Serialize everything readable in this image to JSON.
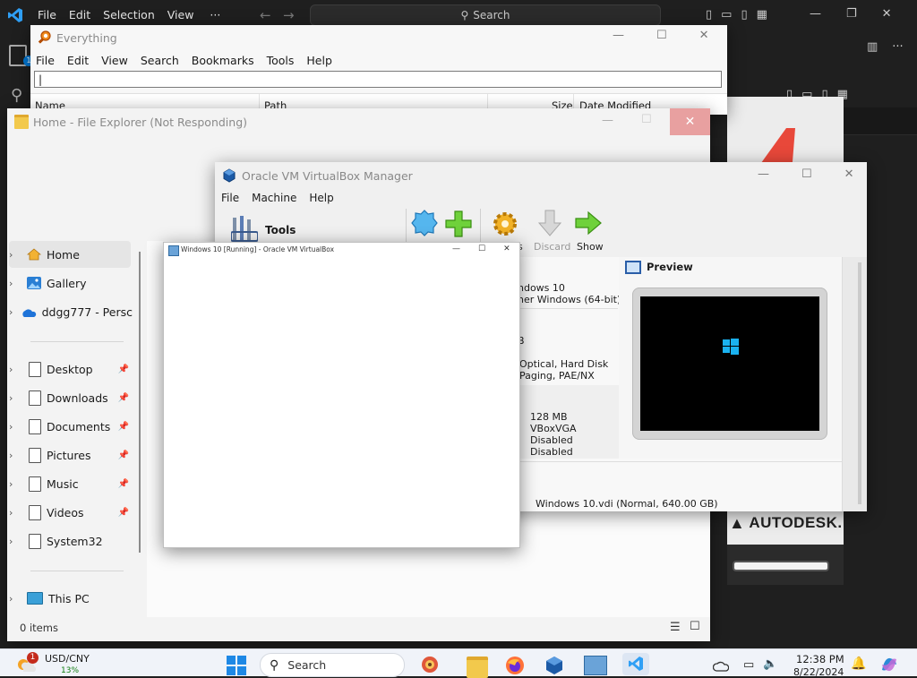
{
  "vscode": {
    "menu": [
      "File",
      "Edit",
      "Selection",
      "View"
    ],
    "more": "···",
    "search_label": "Search"
  },
  "everything": {
    "title": "Everything",
    "menu": [
      "File",
      "Edit",
      "View",
      "Search",
      "Bookmarks",
      "Tools",
      "Help"
    ],
    "search_value": "|",
    "columns": [
      "Name",
      "Path",
      "Size",
      "Date Modified"
    ]
  },
  "explorer": {
    "title": "Home - File Explorer (Not Responding)",
    "nav": [
      {
        "label": "Home",
        "icon": "home-icon"
      },
      {
        "label": "Gallery",
        "icon": "gallery-icon"
      },
      {
        "label": "ddgg777 - Persc",
        "icon": "onedrive-icon"
      }
    ],
    "quick": [
      "Desktop",
      "Downloads",
      "Documents",
      "Pictures",
      "Music",
      "Videos",
      "System32"
    ],
    "this_pc": "This PC",
    "status": "0 items"
  },
  "vbox": {
    "title": "Oracle VM VirtualBox Manager",
    "menu": [
      "File",
      "Machine",
      "Help"
    ],
    "tools_label": "Tools",
    "toolbar": {
      "settings": "s",
      "discard": "Discard",
      "show": "Show"
    },
    "details": {
      "os_name": "ndows 10",
      "os_type": "her Windows (64-bit)",
      "memory_frag": "B",
      "boot": "Optical, Hard Disk",
      "accel": "Paging, PAE/NX",
      "video_mem": "128 MB",
      "controller": "VBoxVGA",
      "rdp": "Disabled",
      "recording": "Disabled",
      "disk": "Windows 10.vdi (Normal, 640.00 GB)"
    },
    "preview_label": "Preview"
  },
  "vm_window": {
    "title": "Windows 10 [Running] - Oracle VM VirtualBox"
  },
  "autodesk": {
    "brand": "AUTODESK."
  },
  "taskbar": {
    "weather_badge": "1",
    "ticker": "USD/CNY",
    "ticker_change": "13%",
    "search_label": "Search",
    "time": "12:38 PM",
    "date": "8/22/2024"
  }
}
